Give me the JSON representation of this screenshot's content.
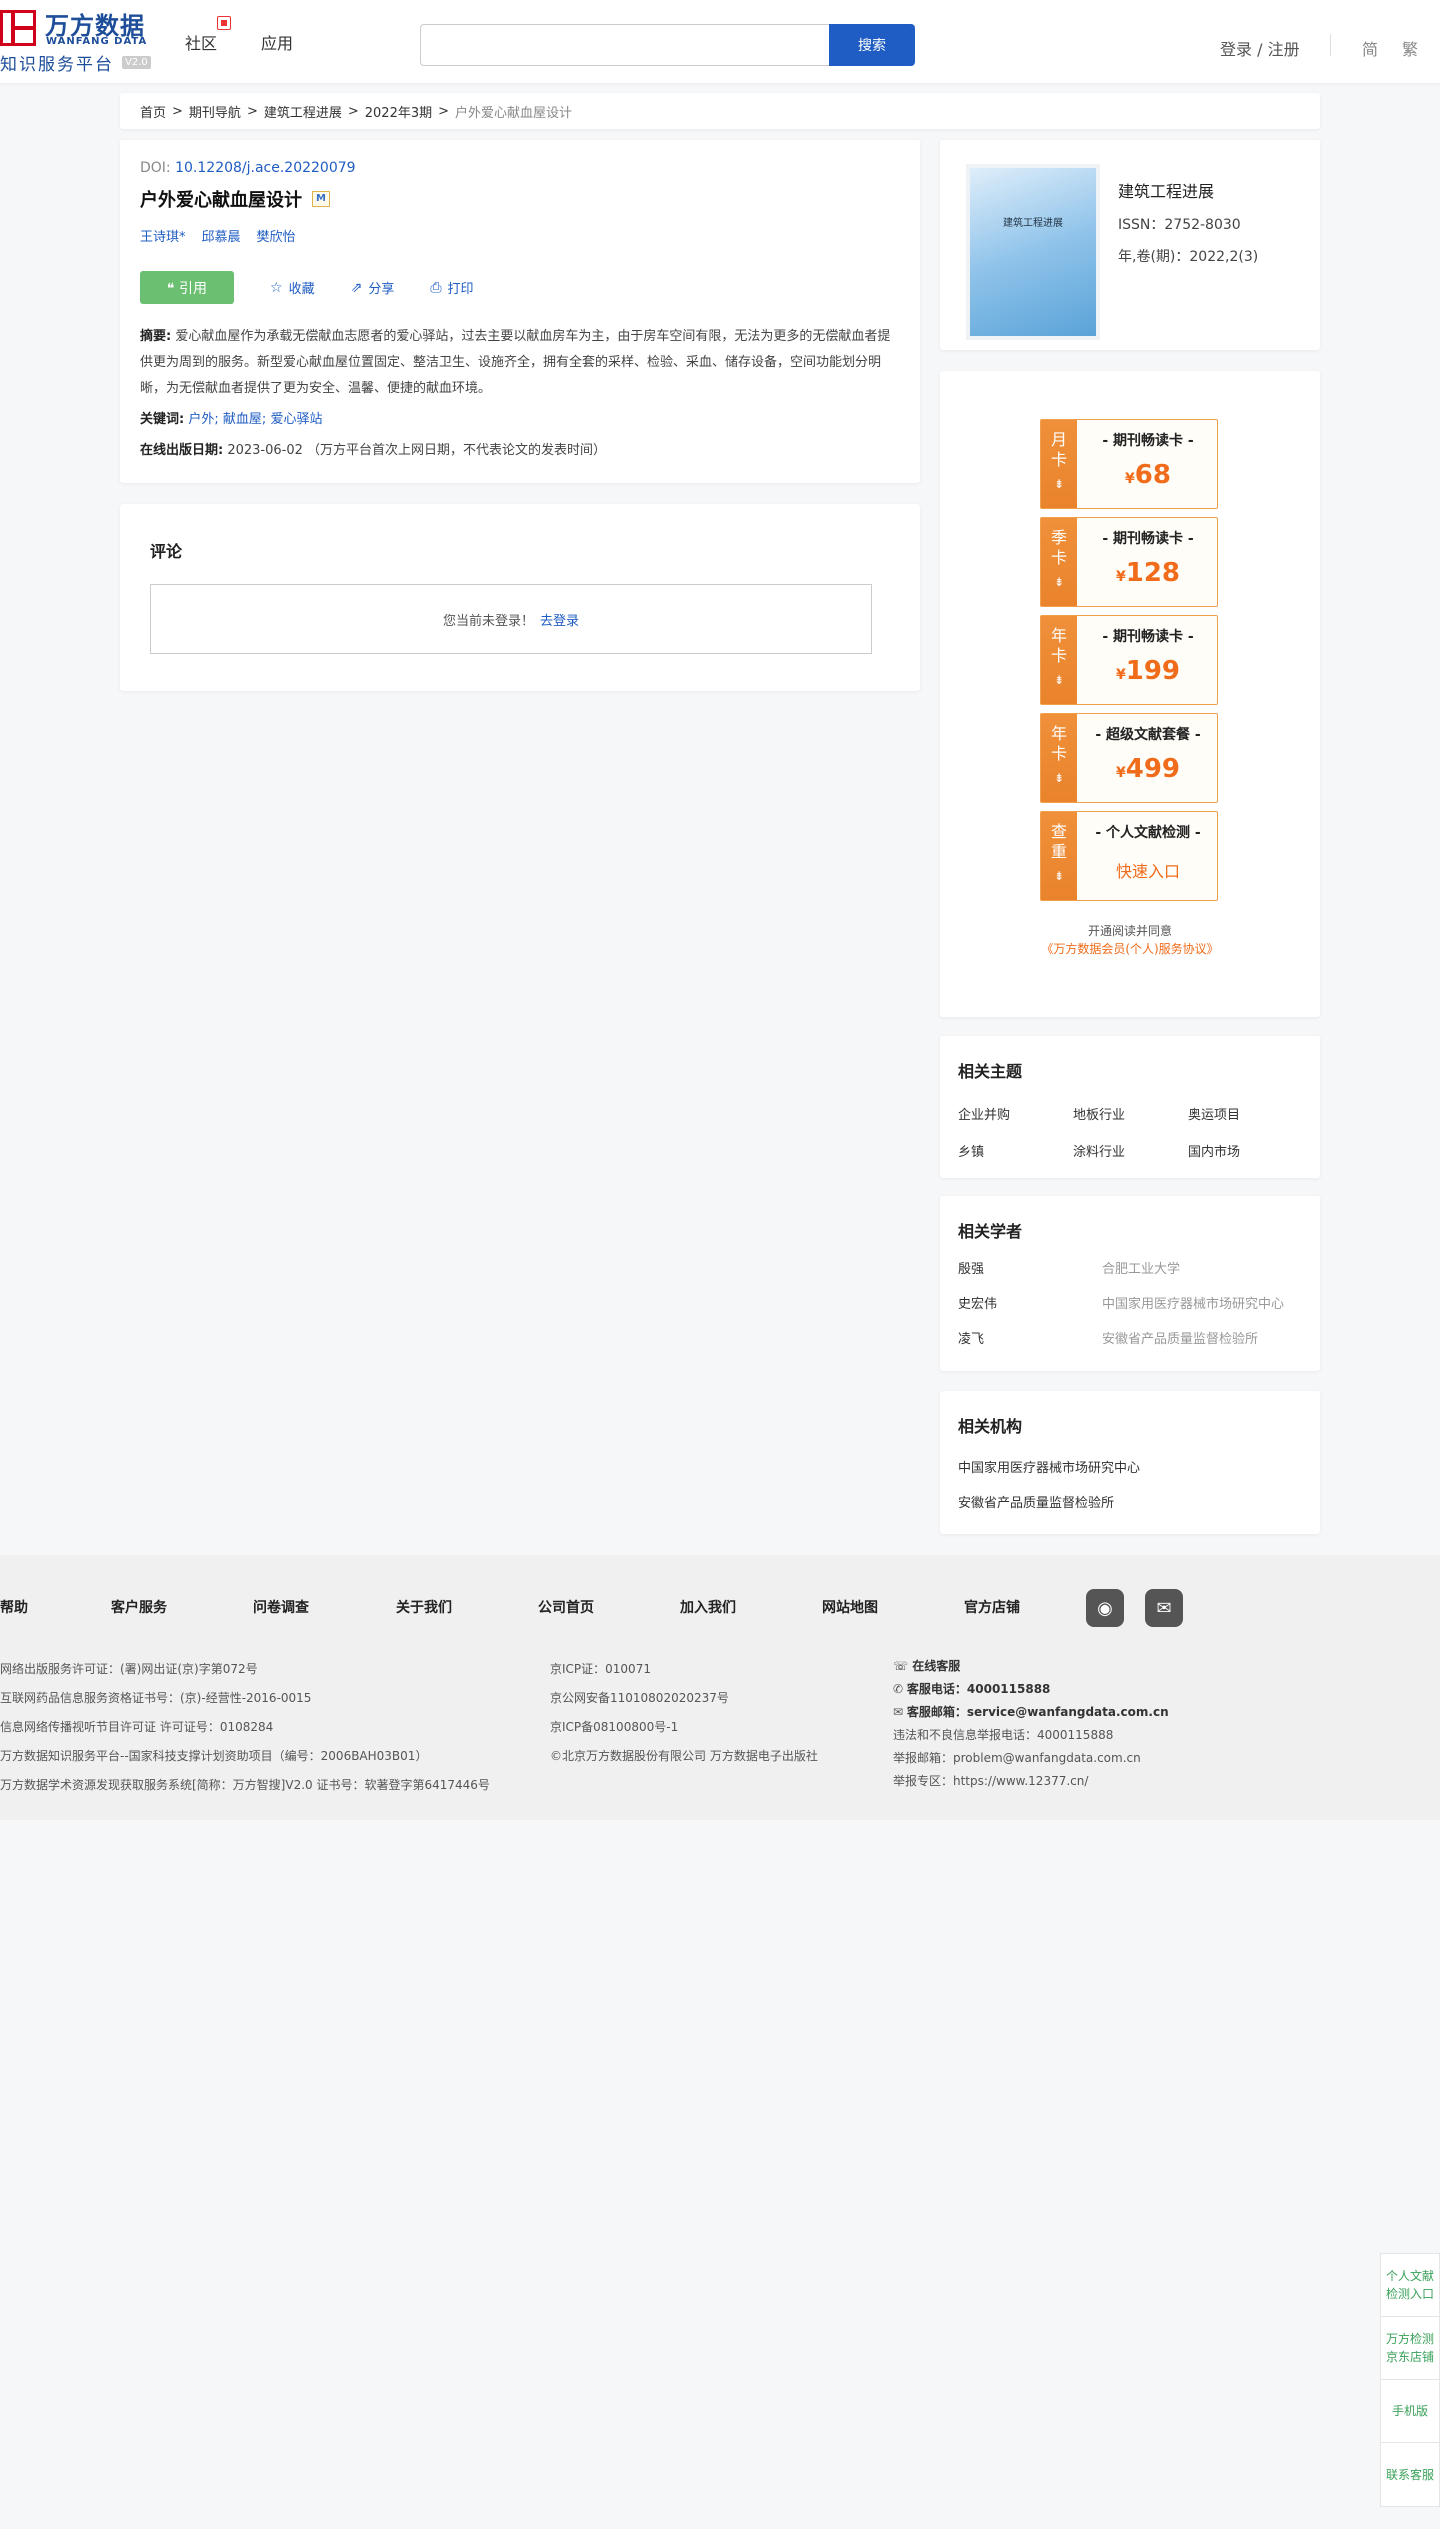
{
  "header": {
    "logo_cn": "万方数据",
    "logo_en": "WANFANG DATA",
    "logo_sub": "知识服务平台",
    "logo_version": "V2.0",
    "nav": {
      "community": "社区",
      "apps": "应用"
    },
    "search_placeholder": "",
    "search_button": "搜索",
    "login": "登录 / 注册",
    "lang_simplified": "简",
    "lang_traditional": "繁"
  },
  "breadcrumb": {
    "items": [
      "首页",
      "期刊导航",
      "建筑工程进展",
      "2022年3期"
    ],
    "current": "户外爱心献血屋设计",
    "separator": ">"
  },
  "article": {
    "doi_label": "DOI:",
    "doi": "10.12208/j.ace.20220079",
    "title": "户外爱心献血屋设计",
    "badge": "M",
    "authors": [
      "王诗琪*",
      "邱慕晨",
      "樊欣怡"
    ],
    "actions": {
      "cite": "引用",
      "favorite": "收藏",
      "share": "分享",
      "print": "打印"
    },
    "abstract_label": "摘要:",
    "abstract": "爱心献血屋作为承载无偿献血志愿者的爱心驿站，过去主要以献血房车为主，由于房车空间有限，无法为更多的无偿献血者提供更为周到的服务。新型爱心献血屋位置固定、整洁卫生、设施齐全，拥有全套的采样、检验、采血、储存设备，空间功能划分明晰，为无偿献血者提供了更为安全、温馨、便捷的献血环境。",
    "keywords_label": "关键词:",
    "keywords": [
      "户外",
      "献血屋",
      "爱心驿站"
    ],
    "keyword_sep": ";",
    "pubdate_label": "在线出版日期:",
    "pubdate": "2023-06-02",
    "pubdate_note": "（万方平台首次上网日期，不代表论文的发表时间）"
  },
  "comments": {
    "title": "评论",
    "not_logged": "您当前未登录！",
    "go_login": "去登录"
  },
  "journal": {
    "cover_title": "建筑工程进展",
    "name": "建筑工程进展",
    "issn": "ISSN：2752-8030",
    "volume": "年,卷(期)：2022,2(3)"
  },
  "membership": {
    "cards": [
      {
        "side": [
          "月",
          "卡"
        ],
        "title": "- 期刊畅读卡 -",
        "currency": "¥",
        "price": "68"
      },
      {
        "side": [
          "季",
          "卡"
        ],
        "title": "- 期刊畅读卡 -",
        "currency": "¥",
        "price": "128"
      },
      {
        "side": [
          "年",
          "卡"
        ],
        "title": "- 期刊畅读卡 -",
        "currency": "¥",
        "price": "199"
      },
      {
        "side": [
          "年",
          "卡"
        ],
        "title": "- 超级文献套餐 -",
        "currency": "¥",
        "price": "499"
      },
      {
        "side": [
          "查",
          "重"
        ],
        "title": "- 个人文献检测 -",
        "entry": "快速入口"
      }
    ],
    "agree_text": "开通阅读并同意",
    "agree_link": "《万方数据会员(个人)服务协议》"
  },
  "related_topics": {
    "title": "相关主题",
    "items": [
      "企业并购",
      "地板行业",
      "奥运项目",
      "乡镇",
      "涂料行业",
      "国内市场"
    ]
  },
  "related_scholars": {
    "title": "相关学者",
    "items": [
      {
        "name": "殷强",
        "inst": "合肥工业大学"
      },
      {
        "name": "史宏伟",
        "inst": "中国家用医疗器械市场研究中心"
      },
      {
        "name": "凌飞",
        "inst": "安徽省产品质量监督检验所"
      }
    ]
  },
  "related_orgs": {
    "title": "相关机构",
    "items": [
      "中国家用医疗器械市场研究中心",
      "安徽省产品质量监督检验所"
    ]
  },
  "footer": {
    "nav": [
      "帮助",
      "客户服务",
      "问卷调查",
      "关于我们",
      "公司首页",
      "加入我们",
      "网站地图",
      "官方店铺"
    ],
    "col1": [
      "网络出版服务许可证：(署)网出证(京)字第072号",
      "互联网药品信息服务资格证书号：(京)-经营性-2016-0015",
      "信息网络传播视听节目许可证 许可证号：0108284",
      "万方数据知识服务平台--国家科技支撑计划资助项目（编号：2006BAH03B01）",
      "万方数据学术资源发现获取服务系统[简称：万方智搜]V2.0 证书号：软著登字第6417446号"
    ],
    "col2": [
      "京ICP证：010071",
      "京公网安备11010802020237号",
      "京ICP备08100800号-1",
      "©北京万方数据股份有限公司 万方数据电子出版社"
    ],
    "online_service": "在线客服",
    "phone_label": "客服电话：",
    "phone": "4000115888",
    "email_label": "客服邮箱：",
    "email": "service@wanfangdata.com.cn",
    "report_phone": "违法和不良信息举报电话：4000115888",
    "report_email": "举报邮箱：problem@wanfangdata.com.cn",
    "report_zone": "举报专区：https://www.12377.cn/"
  },
  "side_widget": [
    "个人文献检测入口",
    "万方检测京东店铺",
    "手机版",
    "联系客服"
  ]
}
